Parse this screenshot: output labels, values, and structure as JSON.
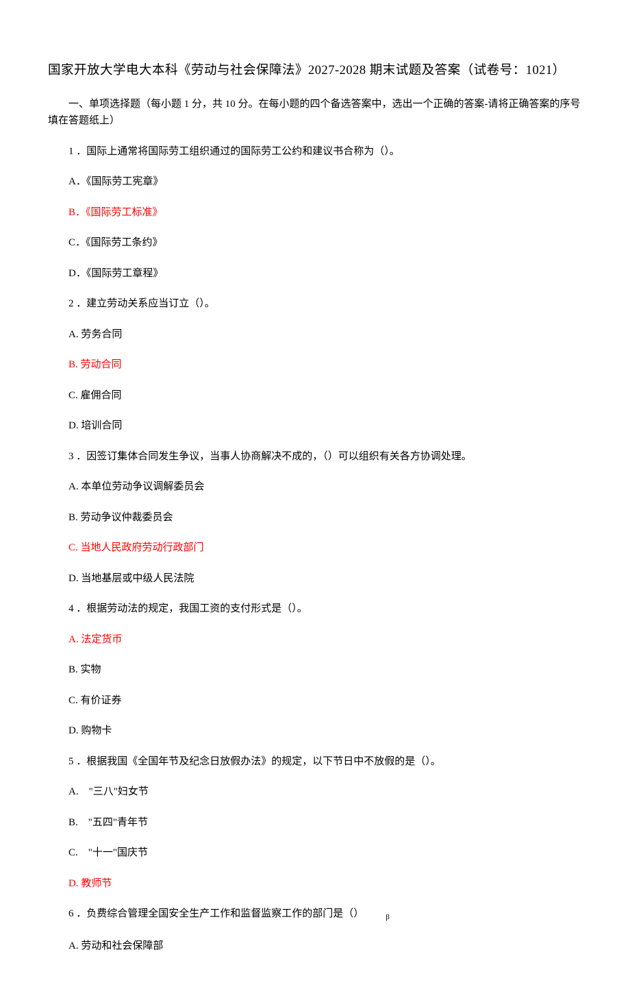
{
  "title": "国家开放大学电大本科《劳动与社会保障法》2027-2028 期末试题及答案（试卷号：1021）",
  "section1_heading": "一、单项选择题（每小题 1 分，共 10 分。在每小题的四个备选答案中，选出一个正确的答案-请将正确答案的序号填在答题纸上）",
  "q1": {
    "stem": "1 ．国际上通常将国际劳工组织通过的国际劳工公约和建议书合称为（）。",
    "a": "A．《国际劳工宪章》",
    "b": "B．《国际劳工标准》",
    "c": "C．《国际劳工条约》",
    "d": "D．《国际劳工章程》"
  },
  "q2": {
    "stem": "2 ．建立劳动关系应当订立（）。",
    "a": "A. 劳务合同",
    "b": "B. 劳动合同",
    "c": "C. 雇佣合同",
    "d": "D. 培训合同"
  },
  "q3": {
    "stem": "3 ．因签订集体合同发生争议，当事人协商解决不成的，（）可以组织有关各方协调处理。",
    "a": "A. 本单位劳动争议调解委员会",
    "b": "B. 劳动争议仲裁委员会",
    "c": "C. 当地人民政府劳动行政部门",
    "d": "D. 当地基层或中级人民法院"
  },
  "q4": {
    "stem": "4 ．根据劳动法的规定，我国工资的支付形式是（）。",
    "a": "A. 法定货币",
    "b": "B. 实物",
    "c": "C. 有价证券",
    "d": "D. 购物卡"
  },
  "q5": {
    "stem": "5 ．根据我国《全国年节及纪念日放假办法》的规定，以下节日中不放假的是（）。",
    "a": "A.　\"三八\"妇女节",
    "b": "B.　\"五四\"青年节",
    "c": "C.　\"十一\"国庆节",
    "d": "D. 教师节"
  },
  "q6": {
    "stem_prefix": "6 ．负费综合管理全国安全生产工作和监督监察工作的部门是（）",
    "stem_sub": "β",
    "a": "A. 劳动和社会保障部"
  }
}
